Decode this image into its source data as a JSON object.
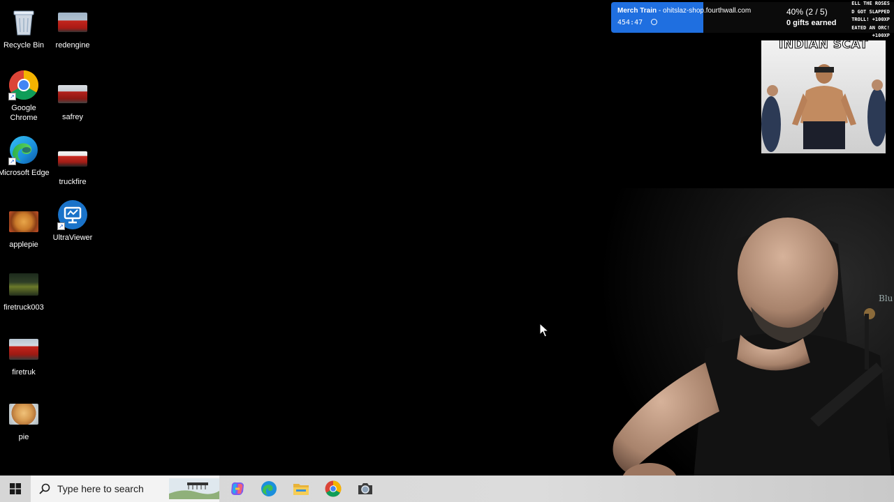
{
  "desktop": {
    "icons": [
      {
        "label": "Recycle Bin",
        "icon": "recycle-bin-icon"
      },
      {
        "label": "redengine",
        "icon": "image-file-icon"
      },
      {
        "label": "Google Chrome",
        "icon": "chrome-icon"
      },
      {
        "label": "safrey",
        "icon": "image-file-icon"
      },
      {
        "label": "Microsoft Edge",
        "icon": "edge-icon"
      },
      {
        "label": "truckfire",
        "icon": "image-file-icon"
      },
      {
        "label": "applepie",
        "icon": "image-file-icon"
      },
      {
        "label": "UltraViewer",
        "icon": "ultraviewer-icon"
      },
      {
        "label": "firetruck003",
        "icon": "image-file-icon"
      },
      {
        "label": "firetruk",
        "icon": "image-file-icon"
      },
      {
        "label": "pie",
        "icon": "image-file-icon"
      }
    ]
  },
  "overlay": {
    "merch_title": "Merch Train",
    "merch_url": " - ohitslaz-shop.fourthwall.com",
    "timer": "454:47",
    "progress_text": "40% (2 / 5)",
    "progress_fraction": 0.4,
    "gifts": "0 gifts earned",
    "ticker": [
      "ELL THE ROSES",
      "D GOT SLAPPED",
      "TROLL! +100XP",
      "EATED AN ORC!",
      "+100XP"
    ],
    "meme_caption": "INDIAN SCAT"
  },
  "taskbar": {
    "search_placeholder": "Type here to search",
    "apps": [
      "copilot-icon",
      "edge-icon",
      "file-explorer-icon",
      "chrome-icon",
      "camera-icon"
    ]
  },
  "colors": {
    "accent": "#1f6fe0",
    "desktop_bg": "#000000",
    "taskbar_bg": "#d6d6d6"
  }
}
